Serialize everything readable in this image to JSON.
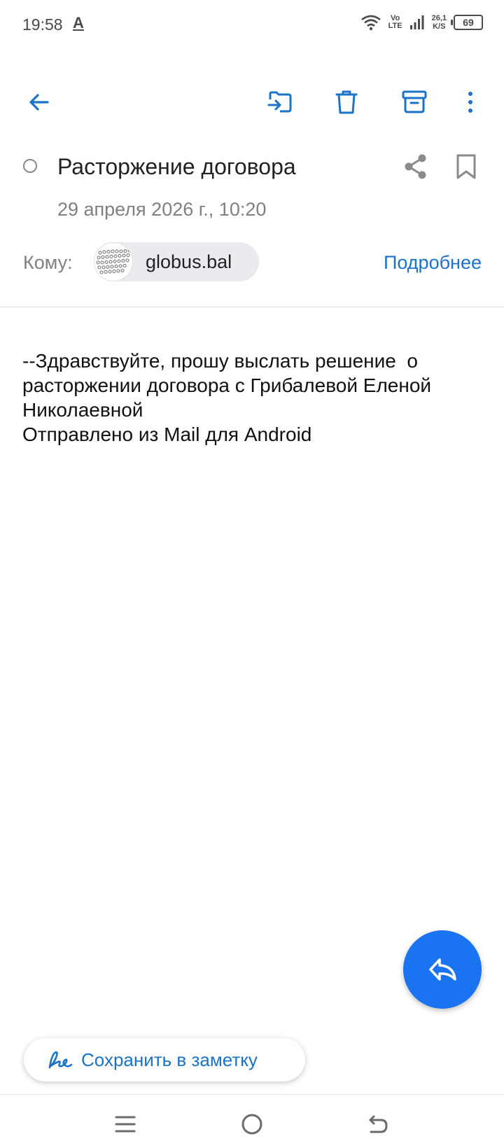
{
  "status_bar": {
    "time": "19:58",
    "notification_letter": "A",
    "network_top": "Vo",
    "network_bottom": "LTE",
    "speed_value": "26,1",
    "speed_unit": "K/S",
    "battery": "69"
  },
  "toolbar": {
    "icons": [
      "back-arrow-icon",
      "move-to-folder-icon",
      "trash-icon",
      "archive-icon",
      "more-vertical-icon"
    ]
  },
  "email": {
    "subject": "Расторжение договора",
    "date": "29 апреля 2026 г., 10:20",
    "to_label": "Кому:",
    "recipient": "globus.bal",
    "details_link": "Подробнее",
    "body_lines": [
      "--Здравствуйте, прошу выслать решение  о",
      "расторжении договора с Грибалевой Еленой",
      "Николаевной",
      "Отправлено из Mail для Android"
    ]
  },
  "actions": {
    "save_note_label": "Сохранить в заметку"
  },
  "colors": {
    "accent": "#1a73c8",
    "fab": "#1a73f0",
    "muted_text": "#808080"
  }
}
